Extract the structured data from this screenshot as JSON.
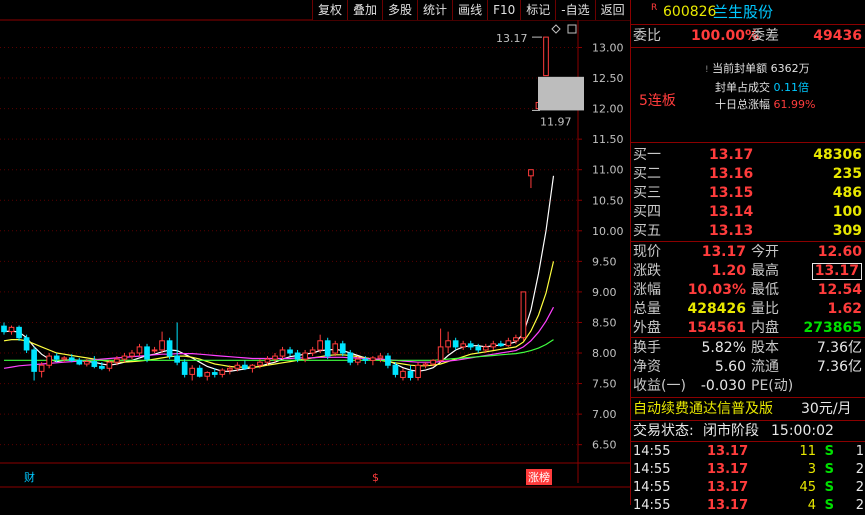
{
  "toolbar": [
    "复权",
    "叠加",
    "多股",
    "统计",
    "画线",
    "F10",
    "标记",
    "-自选",
    "返回"
  ],
  "stock": {
    "marker": "R",
    "code": "600826",
    "name": "兰生股份"
  },
  "committee": {
    "ratio_label": "委比",
    "ratio_value": "100.00%",
    "diff_label": "委差",
    "diff_value": "49436"
  },
  "seal": {
    "streak": "5连板",
    "lines": [
      {
        "label": "当前封单额",
        "value": "6362万"
      },
      {
        "label": "封单占成交",
        "value": "0.11倍"
      },
      {
        "label": "十日总涨幅",
        "value": "61.99%"
      }
    ]
  },
  "bids": [
    {
      "label": "买一",
      "price": "13.17",
      "vol": "48306"
    },
    {
      "label": "买二",
      "price": "13.16",
      "vol": "235"
    },
    {
      "label": "买三",
      "price": "13.15",
      "vol": "486"
    },
    {
      "label": "买四",
      "price": "13.14",
      "vol": "100"
    },
    {
      "label": "买五",
      "price": "13.13",
      "vol": "309"
    }
  ],
  "quote": [
    {
      "l1": "现价",
      "v1": "13.17",
      "l2": "今开",
      "v2": "12.60"
    },
    {
      "l1": "涨跌",
      "v1": "1.20",
      "l2": "最高",
      "v2": "13.17"
    },
    {
      "l1": "涨幅",
      "v1": "10.03%",
      "l2": "最低",
      "v2": "12.54"
    },
    {
      "l1": "总量",
      "v1": "428426",
      "l2": "量比",
      "v2": "1.62"
    },
    {
      "l1": "外盘",
      "v1": "154561",
      "l2": "内盘",
      "v2": "273865"
    }
  ],
  "fundamentals": [
    {
      "l1": "换手",
      "v1": "5.82%",
      "l2": "股本",
      "v2": "7.36亿"
    },
    {
      "l1": "净资",
      "v1": "5.60",
      "l2": "流通",
      "v2": "7.36亿"
    },
    {
      "l1": "收益(一)",
      "v1": "-0.030",
      "l2": "PE(动)",
      "v2": ""
    }
  ],
  "ad": {
    "text": "自动续费通达信普及版",
    "price": "30元/月"
  },
  "trade_status": {
    "label": "交易状态:",
    "state": "闭市阶段",
    "time": "15:00:02"
  },
  "ticks": [
    {
      "time": "14:55",
      "price": "13.17",
      "vol": "11",
      "side": "S",
      "n": "1"
    },
    {
      "time": "14:55",
      "price": "13.17",
      "vol": "3",
      "side": "S",
      "n": "2"
    },
    {
      "time": "14:55",
      "price": "13.17",
      "vol": "45",
      "side": "S",
      "n": "2"
    },
    {
      "time": "14:55",
      "price": "13.17",
      "vol": "4",
      "side": "S",
      "n": "2"
    }
  ],
  "chart_data": {
    "type": "candlestick",
    "y_ticks": [
      "13.00",
      "12.50",
      "12.00",
      "11.50",
      "11.00",
      "10.50",
      "10.00",
      "9.50",
      "9.00",
      "8.50",
      "8.00",
      "7.50",
      "7.00",
      "6.50"
    ],
    "y_range": [
      6.2,
      13.45
    ],
    "high_annotation": "13.17",
    "low_annotation": "11.97",
    "bottom_labels": [
      "财",
      "$",
      "涨榜"
    ],
    "colors": {
      "up": "#ff3c3c",
      "down": "#00e5ff",
      "ma1": "#ffffff",
      "ma2": "#ffff40",
      "ma3": "#ff40ff",
      "ma4": "#40ff40"
    },
    "candles": [
      {
        "o": 8.44,
        "h": 8.5,
        "l": 8.3,
        "c": 8.35
      },
      {
        "o": 8.35,
        "h": 8.45,
        "l": 8.3,
        "c": 8.42
      },
      {
        "o": 8.42,
        "h": 8.45,
        "l": 8.2,
        "c": 8.25
      },
      {
        "o": 8.25,
        "h": 8.3,
        "l": 8.0,
        "c": 8.05
      },
      {
        "o": 8.05,
        "h": 8.1,
        "l": 7.55,
        "c": 7.7
      },
      {
        "o": 7.7,
        "h": 7.85,
        "l": 7.6,
        "c": 7.8
      },
      {
        "o": 7.8,
        "h": 8.0,
        "l": 7.75,
        "c": 7.95
      },
      {
        "o": 7.95,
        "h": 8.0,
        "l": 7.85,
        "c": 7.9
      },
      {
        "o": 7.9,
        "h": 7.95,
        "l": 7.85,
        "c": 7.92
      },
      {
        "o": 7.92,
        "h": 7.98,
        "l": 7.85,
        "c": 7.88
      },
      {
        "o": 7.88,
        "h": 7.92,
        "l": 7.8,
        "c": 7.82
      },
      {
        "o": 7.82,
        "h": 7.9,
        "l": 7.78,
        "c": 7.86
      },
      {
        "o": 7.86,
        "h": 7.95,
        "l": 7.75,
        "c": 7.78
      },
      {
        "o": 7.78,
        "h": 7.85,
        "l": 7.72,
        "c": 7.75
      },
      {
        "o": 7.75,
        "h": 7.88,
        "l": 7.7,
        "c": 7.85
      },
      {
        "o": 7.85,
        "h": 7.95,
        "l": 7.8,
        "c": 7.9
      },
      {
        "o": 7.9,
        "h": 8.0,
        "l": 7.85,
        "c": 7.95
      },
      {
        "o": 7.95,
        "h": 8.05,
        "l": 7.9,
        "c": 8.0
      },
      {
        "o": 8.0,
        "h": 8.15,
        "l": 7.95,
        "c": 8.1
      },
      {
        "o": 8.1,
        "h": 8.15,
        "l": 7.85,
        "c": 7.9
      },
      {
        "o": 8.05,
        "h": 8.1,
        "l": 8.0,
        "c": 8.05
      },
      {
        "o": 8.05,
        "h": 8.35,
        "l": 8.0,
        "c": 8.2
      },
      {
        "o": 8.2,
        "h": 8.25,
        "l": 7.9,
        "c": 7.95
      },
      {
        "o": 7.95,
        "h": 8.5,
        "l": 7.8,
        "c": 7.85
      },
      {
        "o": 7.85,
        "h": 7.9,
        "l": 7.6,
        "c": 7.65
      },
      {
        "o": 7.65,
        "h": 7.8,
        "l": 7.55,
        "c": 7.75
      },
      {
        "o": 7.75,
        "h": 7.8,
        "l": 7.6,
        "c": 7.62
      },
      {
        "o": 7.62,
        "h": 7.7,
        "l": 7.55,
        "c": 7.68
      },
      {
        "o": 7.68,
        "h": 7.75,
        "l": 7.6,
        "c": 7.65
      },
      {
        "o": 7.65,
        "h": 7.75,
        "l": 7.6,
        "c": 7.72
      },
      {
        "o": 7.72,
        "h": 7.8,
        "l": 7.65,
        "c": 7.75
      },
      {
        "o": 7.75,
        "h": 7.85,
        "l": 7.7,
        "c": 7.8
      },
      {
        "o": 7.8,
        "h": 7.88,
        "l": 7.72,
        "c": 7.75
      },
      {
        "o": 7.75,
        "h": 7.82,
        "l": 7.68,
        "c": 7.8
      },
      {
        "o": 7.8,
        "h": 7.9,
        "l": 7.75,
        "c": 7.85
      },
      {
        "o": 7.85,
        "h": 7.95,
        "l": 7.8,
        "c": 7.9
      },
      {
        "o": 7.9,
        "h": 8.0,
        "l": 7.85,
        "c": 7.95
      },
      {
        "o": 7.95,
        "h": 8.1,
        "l": 7.9,
        "c": 8.05
      },
      {
        "o": 8.05,
        "h": 8.1,
        "l": 7.95,
        "c": 8.0
      },
      {
        "o": 8.0,
        "h": 8.05,
        "l": 7.85,
        "c": 7.9
      },
      {
        "o": 7.9,
        "h": 8.05,
        "l": 7.85,
        "c": 8.0
      },
      {
        "o": 8.0,
        "h": 8.1,
        "l": 7.95,
        "c": 8.05
      },
      {
        "o": 8.05,
        "h": 8.3,
        "l": 8.0,
        "c": 8.2
      },
      {
        "o": 8.2,
        "h": 8.25,
        "l": 7.9,
        "c": 7.95
      },
      {
        "o": 8.0,
        "h": 8.2,
        "l": 7.95,
        "c": 8.15
      },
      {
        "o": 8.15,
        "h": 8.2,
        "l": 7.95,
        "c": 8.0
      },
      {
        "o": 8.0,
        "h": 8.05,
        "l": 7.8,
        "c": 7.85
      },
      {
        "o": 7.85,
        "h": 7.95,
        "l": 7.8,
        "c": 7.9
      },
      {
        "o": 7.9,
        "h": 7.95,
        "l": 7.82,
        "c": 7.88
      },
      {
        "o": 7.88,
        "h": 7.95,
        "l": 7.8,
        "c": 7.92
      },
      {
        "o": 7.92,
        "h": 8.0,
        "l": 7.85,
        "c": 7.95
      },
      {
        "o": 7.95,
        "h": 8.0,
        "l": 7.75,
        "c": 7.8
      },
      {
        "o": 7.8,
        "h": 7.85,
        "l": 7.6,
        "c": 7.65
      },
      {
        "o": 7.6,
        "h": 7.75,
        "l": 7.55,
        "c": 7.7
      },
      {
        "o": 7.7,
        "h": 7.8,
        "l": 7.55,
        "c": 7.6
      },
      {
        "o": 7.6,
        "h": 7.85,
        "l": 7.55,
        "c": 7.8
      },
      {
        "o": 7.8,
        "h": 7.85,
        "l": 7.75,
        "c": 7.82
      },
      {
        "o": 7.82,
        "h": 7.9,
        "l": 7.78,
        "c": 7.88
      },
      {
        "o": 7.88,
        "h": 8.4,
        "l": 7.85,
        "c": 8.1
      },
      {
        "o": 8.1,
        "h": 8.35,
        "l": 8.0,
        "c": 8.2
      },
      {
        "o": 8.2,
        "h": 8.25,
        "l": 8.05,
        "c": 8.1
      },
      {
        "o": 8.1,
        "h": 8.2,
        "l": 8.05,
        "c": 8.15
      },
      {
        "o": 8.15,
        "h": 8.2,
        "l": 8.05,
        "c": 8.1
      },
      {
        "o": 8.1,
        "h": 8.15,
        "l": 8.0,
        "c": 8.05
      },
      {
        "o": 8.05,
        "h": 8.15,
        "l": 8.0,
        "c": 8.1
      },
      {
        "o": 8.1,
        "h": 8.2,
        "l": 8.05,
        "c": 8.15
      },
      {
        "o": 8.15,
        "h": 8.2,
        "l": 8.1,
        "c": 8.12
      },
      {
        "o": 8.12,
        "h": 8.25,
        "l": 8.1,
        "c": 8.2
      },
      {
        "o": 8.2,
        "h": 8.3,
        "l": 8.15,
        "c": 8.25
      },
      {
        "o": 8.25,
        "h": 9.0,
        "l": 8.2,
        "c": 9.0
      },
      {
        "o": 10.9,
        "h": 11.0,
        "l": 10.7,
        "c": 11.0
      },
      {
        "o": 12.0,
        "h": 12.1,
        "l": 11.97,
        "c": 12.1
      },
      {
        "o": 12.54,
        "h": 13.17,
        "l": 12.54,
        "c": 13.17
      }
    ],
    "ma1": [
      8.35,
      8.36,
      8.34,
      8.25,
      8.1,
      7.98,
      7.9,
      7.86,
      7.88,
      7.89,
      7.88,
      7.86,
      7.85,
      7.82,
      7.8,
      7.82,
      7.85,
      7.88,
      7.92,
      7.96,
      7.98,
      8.02,
      8.05,
      8.04,
      7.98,
      7.92,
      7.85,
      7.78,
      7.74,
      7.7,
      7.7,
      7.72,
      7.74,
      7.76,
      7.78,
      7.82,
      7.85,
      7.9,
      7.94,
      7.96,
      7.98,
      8.0,
      8.04,
      8.05,
      8.06,
      8.04,
      8.0,
      7.96,
      7.92,
      7.9,
      7.9,
      7.88,
      7.82,
      7.76,
      7.72,
      7.7,
      7.72,
      7.76,
      7.85,
      7.96,
      8.05,
      8.1,
      8.12,
      8.12,
      8.1,
      8.12,
      8.13,
      8.15,
      8.18,
      8.32,
      8.7,
      9.3,
      10.0,
      10.9
    ],
    "ma2": [
      8.2,
      8.22,
      8.22,
      8.2,
      8.15,
      8.1,
      8.05,
      8.0,
      7.98,
      7.96,
      7.94,
      7.92,
      7.9,
      7.88,
      7.86,
      7.85,
      7.85,
      7.86,
      7.87,
      7.88,
      7.9,
      7.92,
      7.94,
      7.95,
      7.95,
      7.93,
      7.9,
      7.86,
      7.82,
      7.8,
      7.78,
      7.77,
      7.77,
      7.77,
      7.78,
      7.8,
      7.82,
      7.84,
      7.86,
      7.88,
      7.9,
      7.92,
      7.94,
      7.96,
      7.97,
      7.97,
      7.96,
      7.94,
      7.92,
      7.9,
      7.88,
      7.86,
      7.84,
      7.82,
      7.8,
      7.79,
      7.79,
      7.8,
      7.82,
      7.86,
      7.9,
      7.94,
      7.98,
      8.0,
      8.02,
      8.04,
      8.06,
      8.08,
      8.1,
      8.18,
      8.36,
      8.62,
      8.98,
      9.5
    ],
    "ma3": [
      7.75,
      7.77,
      7.79,
      7.8,
      7.81,
      7.82,
      7.83,
      7.84,
      7.85,
      7.86,
      7.87,
      7.88,
      7.89,
      7.9,
      7.91,
      7.92,
      7.93,
      7.94,
      7.95,
      7.96,
      7.97,
      7.98,
      7.98,
      7.99,
      7.99,
      7.99,
      7.98,
      7.97,
      7.96,
      7.95,
      7.94,
      7.93,
      7.92,
      7.91,
      7.91,
      7.91,
      7.91,
      7.91,
      7.91,
      7.92,
      7.92,
      7.92,
      7.93,
      7.93,
      7.93,
      7.93,
      7.92,
      7.92,
      7.91,
      7.9,
      7.9,
      7.89,
      7.88,
      7.87,
      7.86,
      7.85,
      7.85,
      7.85,
      7.86,
      7.87,
      7.88,
      7.9,
      7.92,
      7.94,
      7.96,
      7.98,
      8.0,
      8.02,
      8.04,
      8.1,
      8.2,
      8.34,
      8.52,
      8.75
    ],
    "ma4": [
      7.88,
      7.88,
      7.88,
      7.88,
      7.88,
      7.88,
      7.88,
      7.88,
      7.88,
      7.88,
      7.88,
      7.88,
      7.88,
      7.88,
      7.88,
      7.88,
      7.88,
      7.88,
      7.88,
      7.88,
      7.88,
      7.88,
      7.88,
      7.88,
      7.88,
      7.88,
      7.88,
      7.88,
      7.88,
      7.88,
      7.88,
      7.88,
      7.88,
      7.88,
      7.88,
      7.88,
      7.88,
      7.88,
      7.88,
      7.88,
      7.88,
      7.88,
      7.88,
      7.88,
      7.88,
      7.88,
      7.88,
      7.88,
      7.88,
      7.88,
      7.88,
      7.88,
      7.88,
      7.88,
      7.88,
      7.88,
      7.88,
      7.88,
      7.89,
      7.9,
      7.91,
      7.92,
      7.93,
      7.94,
      7.95,
      7.96,
      7.97,
      7.98,
      7.99,
      8.01,
      8.04,
      8.08,
      8.14,
      8.22
    ]
  }
}
